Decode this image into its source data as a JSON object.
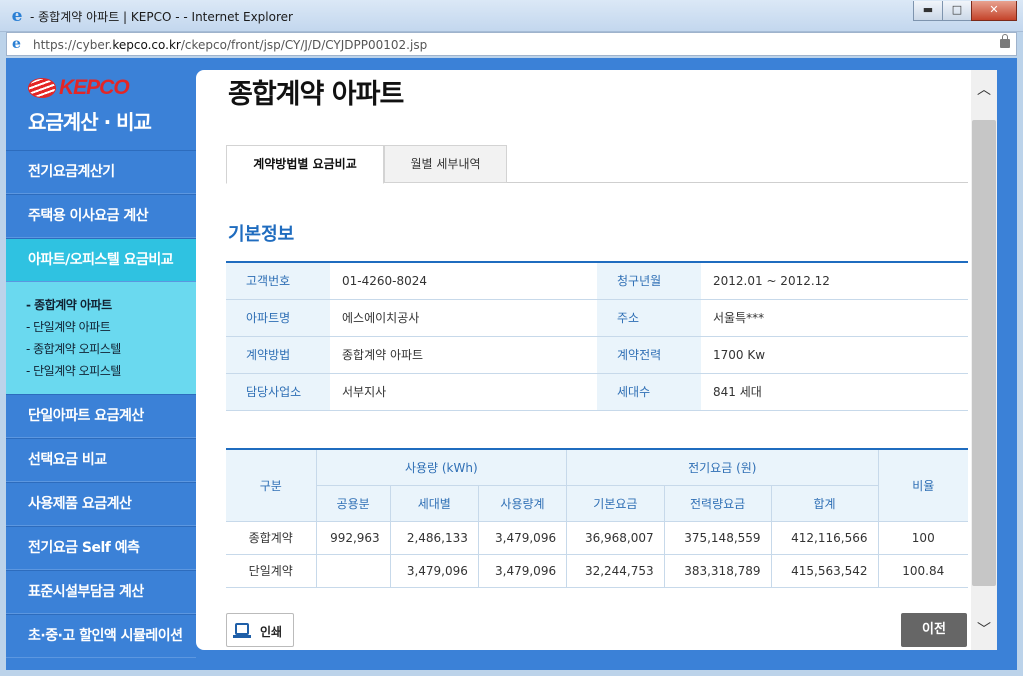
{
  "window": {
    "title": "- 종합계약 아파트 | KEPCO - - Internet Explorer",
    "url_prefix": "https://cyber.",
    "url_domain": "kepco.co.kr",
    "url_path": "/ckepco/front/jsp/CY/J/D/CYJDPP00102.jsp",
    "ie_icon": "ie-icon",
    "minimize": "▬",
    "maximize": "□",
    "close": "✕"
  },
  "brand": {
    "logo": "KEPCO",
    "subtitle": "요금계산 · 비교"
  },
  "sidebar": {
    "items": [
      {
        "label": "전기요금계산기"
      },
      {
        "label": "주택용 이사요금 계산"
      },
      {
        "label": "아파트/오피스텔 요금비교"
      },
      {
        "label": "단일아파트 요금계산"
      },
      {
        "label": "선택요금 비교"
      },
      {
        "label": "사용제품 요금계산"
      },
      {
        "label": "전기요금 Self 예측"
      },
      {
        "label": "표준시설부담금 계산"
      },
      {
        "label": "초·중·고 할인액 시뮬레이션"
      }
    ],
    "submenu": [
      {
        "label": "- 종합계약 아파트"
      },
      {
        "label": "- 단일계약 아파트"
      },
      {
        "label": "- 종합계약 오피스텔"
      },
      {
        "label": "- 단일계약 오피스텔"
      }
    ]
  },
  "page": {
    "title": "종합계약 아파트",
    "tabs": [
      {
        "label": "계약방법별 요금비교"
      },
      {
        "label": "월별 세부내역"
      }
    ],
    "section_title": "기본정보"
  },
  "info": {
    "rows": [
      {
        "l1": "고객번호",
        "v1": "01-4260-8024",
        "l2": "청구년월",
        "v2": "2012.01 ~ 2012.12"
      },
      {
        "l1": "아파트명",
        "v1": "에스에이치공사",
        "l2": "주소",
        "v2": "서울특***"
      },
      {
        "l1": "계약방법",
        "v1": "종합계약 아파트",
        "l2": "계약전력",
        "v2": "1700 Kw"
      },
      {
        "l1": "담당사업소",
        "v1": "서부지사",
        "l2": "세대수",
        "v2": "841 세대"
      }
    ]
  },
  "comparison": {
    "headers": {
      "category": "구분",
      "usage_group": "사용량 (kWh)",
      "charge_group": "전기요금 (원)",
      "ratio": "비율",
      "common": "공용분",
      "household": "세대별",
      "usage_total": "사용량계",
      "base": "기본요금",
      "energy": "전력량요금",
      "sum": "합계"
    },
    "rows": [
      {
        "category": "종합계약",
        "common": "992,963",
        "household": "2,486,133",
        "usage_total": "3,479,096",
        "base": "36,968,007",
        "energy": "375,148,559",
        "sum": "412,116,566",
        "ratio": "100"
      },
      {
        "category": "단일계약",
        "common": "",
        "household": "3,479,096",
        "usage_total": "3,479,096",
        "base": "32,244,753",
        "energy": "383,318,789",
        "sum": "415,563,542",
        "ratio": "100.84"
      }
    ]
  },
  "buttons": {
    "print": "인쇄",
    "prev": "이전"
  },
  "scrollbar": {
    "up": "︿",
    "down": "﹀"
  },
  "colors": {
    "sidebar_bg": "#3b81d7",
    "active_menu": "#2fc2e1",
    "submenu_bg": "#6ad9ef",
    "accent": "#1f6cbf"
  }
}
